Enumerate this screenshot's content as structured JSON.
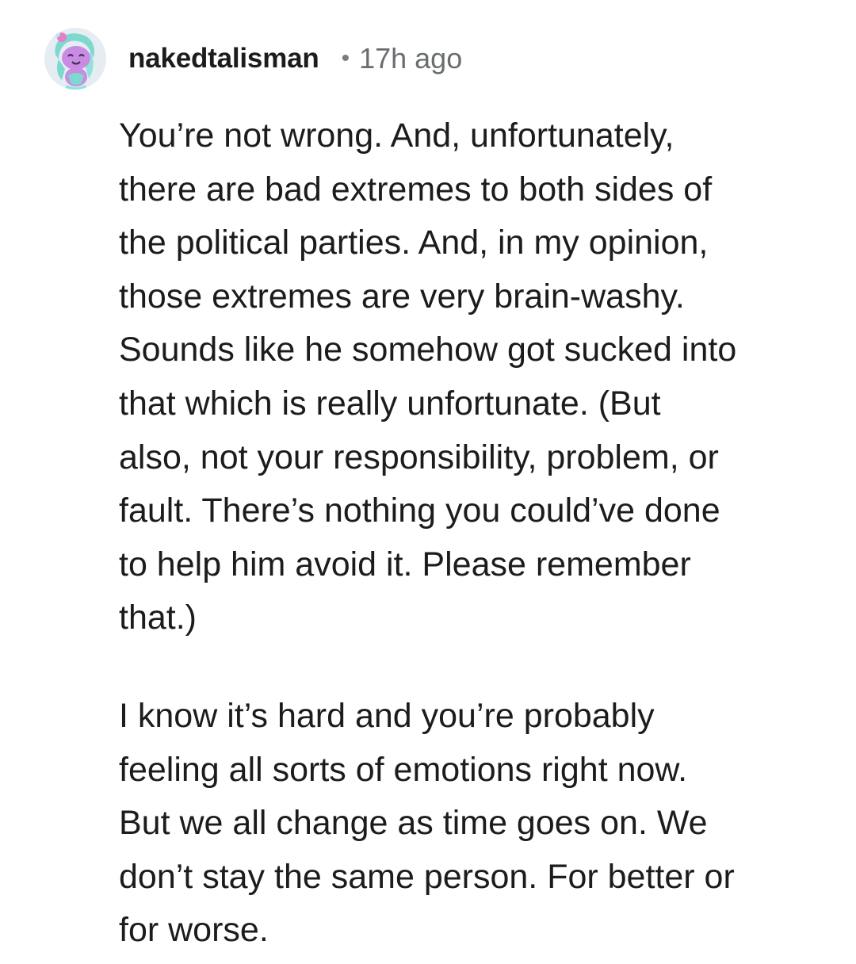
{
  "comment": {
    "author": {
      "username": "nakedtalisman",
      "avatar_icon": "snoo-avatar-icon"
    },
    "separator": "•",
    "timestamp": "17h ago",
    "paragraphs": [
      "You’re not wrong. And, unfortunately,\nthere are bad extremes to both sides of\nthe political parties. And, in my opinion,\nthose extremes are very brain-washy.\nSounds like he somehow got sucked into\nthat which is really unfortunate. (But\nalso, not your responsibility, problem, or\nfault. There’s nothing you could’ve done\nto help him avoid it. Please remember\nthat.)",
      "I know it’s hard and you’re probably\nfeeling all sorts of emotions right now.\nBut we all change as time goes on. We\ndon’t stay the same person. For better or\nfor worse."
    ]
  },
  "colors": {
    "text": "#1c1c1c",
    "meta": "#6a6d70",
    "background": "#ffffff"
  }
}
